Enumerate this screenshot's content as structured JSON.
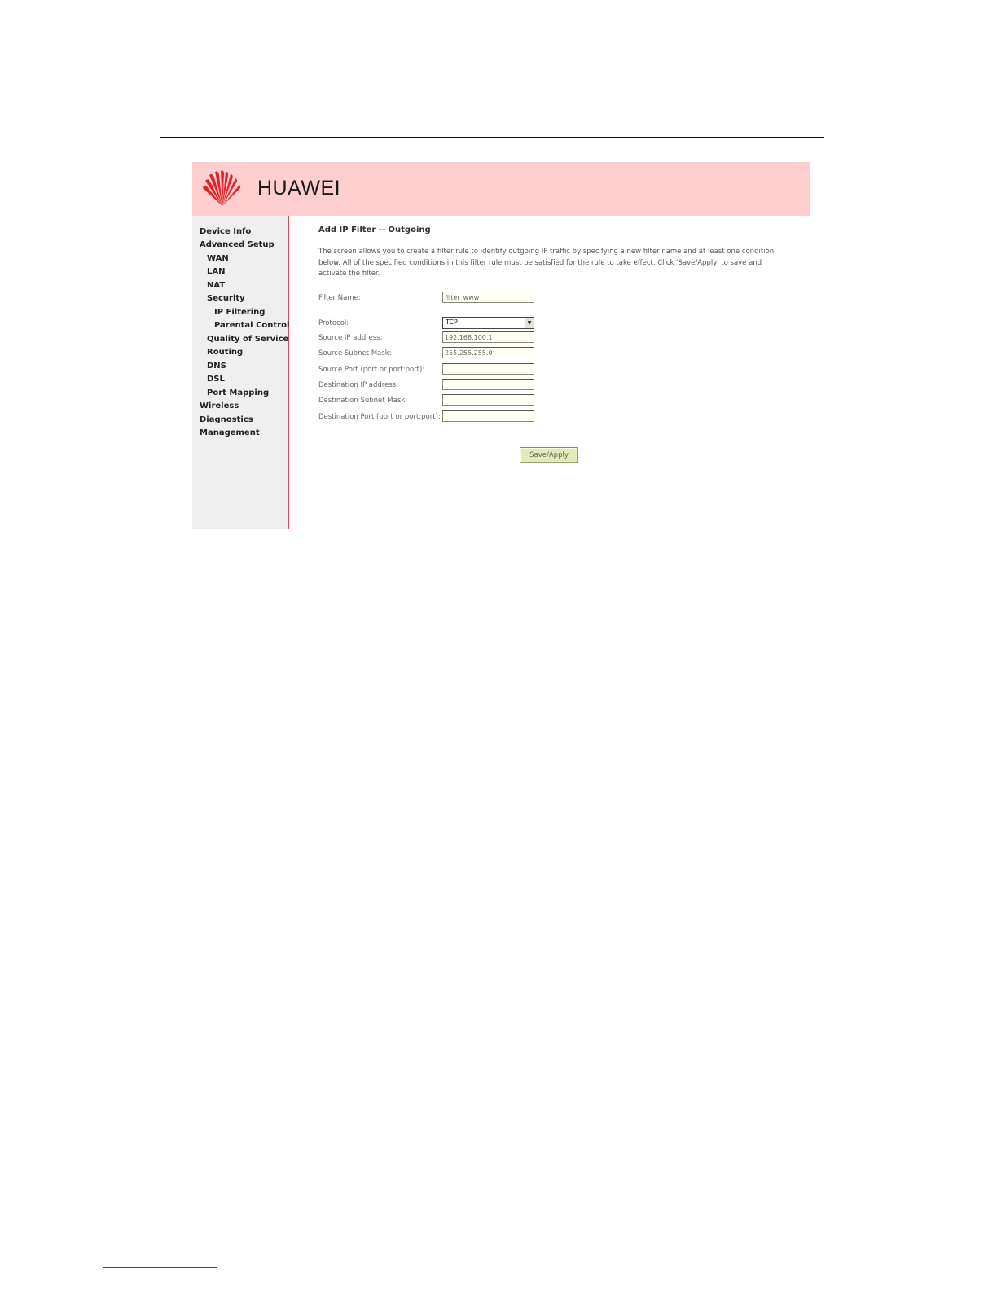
{
  "brand": {
    "name": "HUAWEI"
  },
  "sidebar": {
    "items": [
      {
        "label": "Device Info"
      },
      {
        "label": "Advanced Setup"
      },
      {
        "label": "WAN"
      },
      {
        "label": "LAN"
      },
      {
        "label": "NAT"
      },
      {
        "label": "Security"
      },
      {
        "label": "IP Filtering"
      },
      {
        "label": "Parental Control"
      },
      {
        "label": "Quality of Service"
      },
      {
        "label": "Routing"
      },
      {
        "label": "DNS"
      },
      {
        "label": "DSL"
      },
      {
        "label": "Port Mapping"
      },
      {
        "label": "Wireless"
      },
      {
        "label": "Diagnostics"
      },
      {
        "label": "Management"
      }
    ]
  },
  "main": {
    "title": "Add IP Filter -- Outgoing",
    "description": "The screen allows you to create a filter rule to identify outgoing IP traffic by specifying a new filter name and at least one condition below. All of the specified conditions in this filter rule must be satisfied for the rule to take effect. Click 'Save/Apply' to save and activate the filter.",
    "form": {
      "filter_name": {
        "label": "Filter Name:",
        "value": "filter_www"
      },
      "protocol": {
        "label": "Protocol:",
        "value": "TCP"
      },
      "source_ip": {
        "label": "Source IP address:",
        "value": "192.168.100.1"
      },
      "source_mask": {
        "label": "Source Subnet Mask:",
        "value": "255.255.255.0"
      },
      "source_port": {
        "label": "Source Port (port or port:port):",
        "value": ""
      },
      "dest_ip": {
        "label": "Destination IP address:",
        "value": ""
      },
      "dest_mask": {
        "label": "Destination Subnet Mask:",
        "value": ""
      },
      "dest_port": {
        "label": "Destination Port (port or port:port):",
        "value": ""
      }
    },
    "save_label": "Save/Apply"
  },
  "colors": {
    "banner": "#ffcfcf",
    "sidebar": "#efefef",
    "sidebar_border": "#d24b5a",
    "logo_red": "#e0242a",
    "button": "#e3ecb9"
  },
  "icons": {
    "logo": "huawei-logo-icon",
    "dropdown": "chevron-down-icon"
  }
}
